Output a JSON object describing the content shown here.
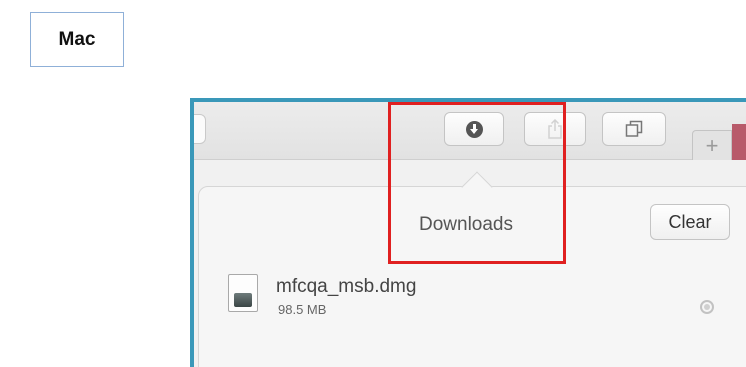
{
  "label": {
    "os": "Mac"
  },
  "toolbar": {
    "buttons": [
      "download-icon",
      "share-icon",
      "tabs-overview-icon"
    ],
    "new_tab_glyph": "+"
  },
  "downloads_popover": {
    "title": "Downloads",
    "clear_label": "Clear",
    "items": [
      {
        "file_name": "mfcqa_msb.dmg",
        "size": "98.5 MB",
        "icon": "disk-image-icon",
        "action_icon": "reveal-magnifier-icon"
      }
    ]
  },
  "colors": {
    "highlight": "#e02020",
    "frame": "#3a98b9"
  }
}
